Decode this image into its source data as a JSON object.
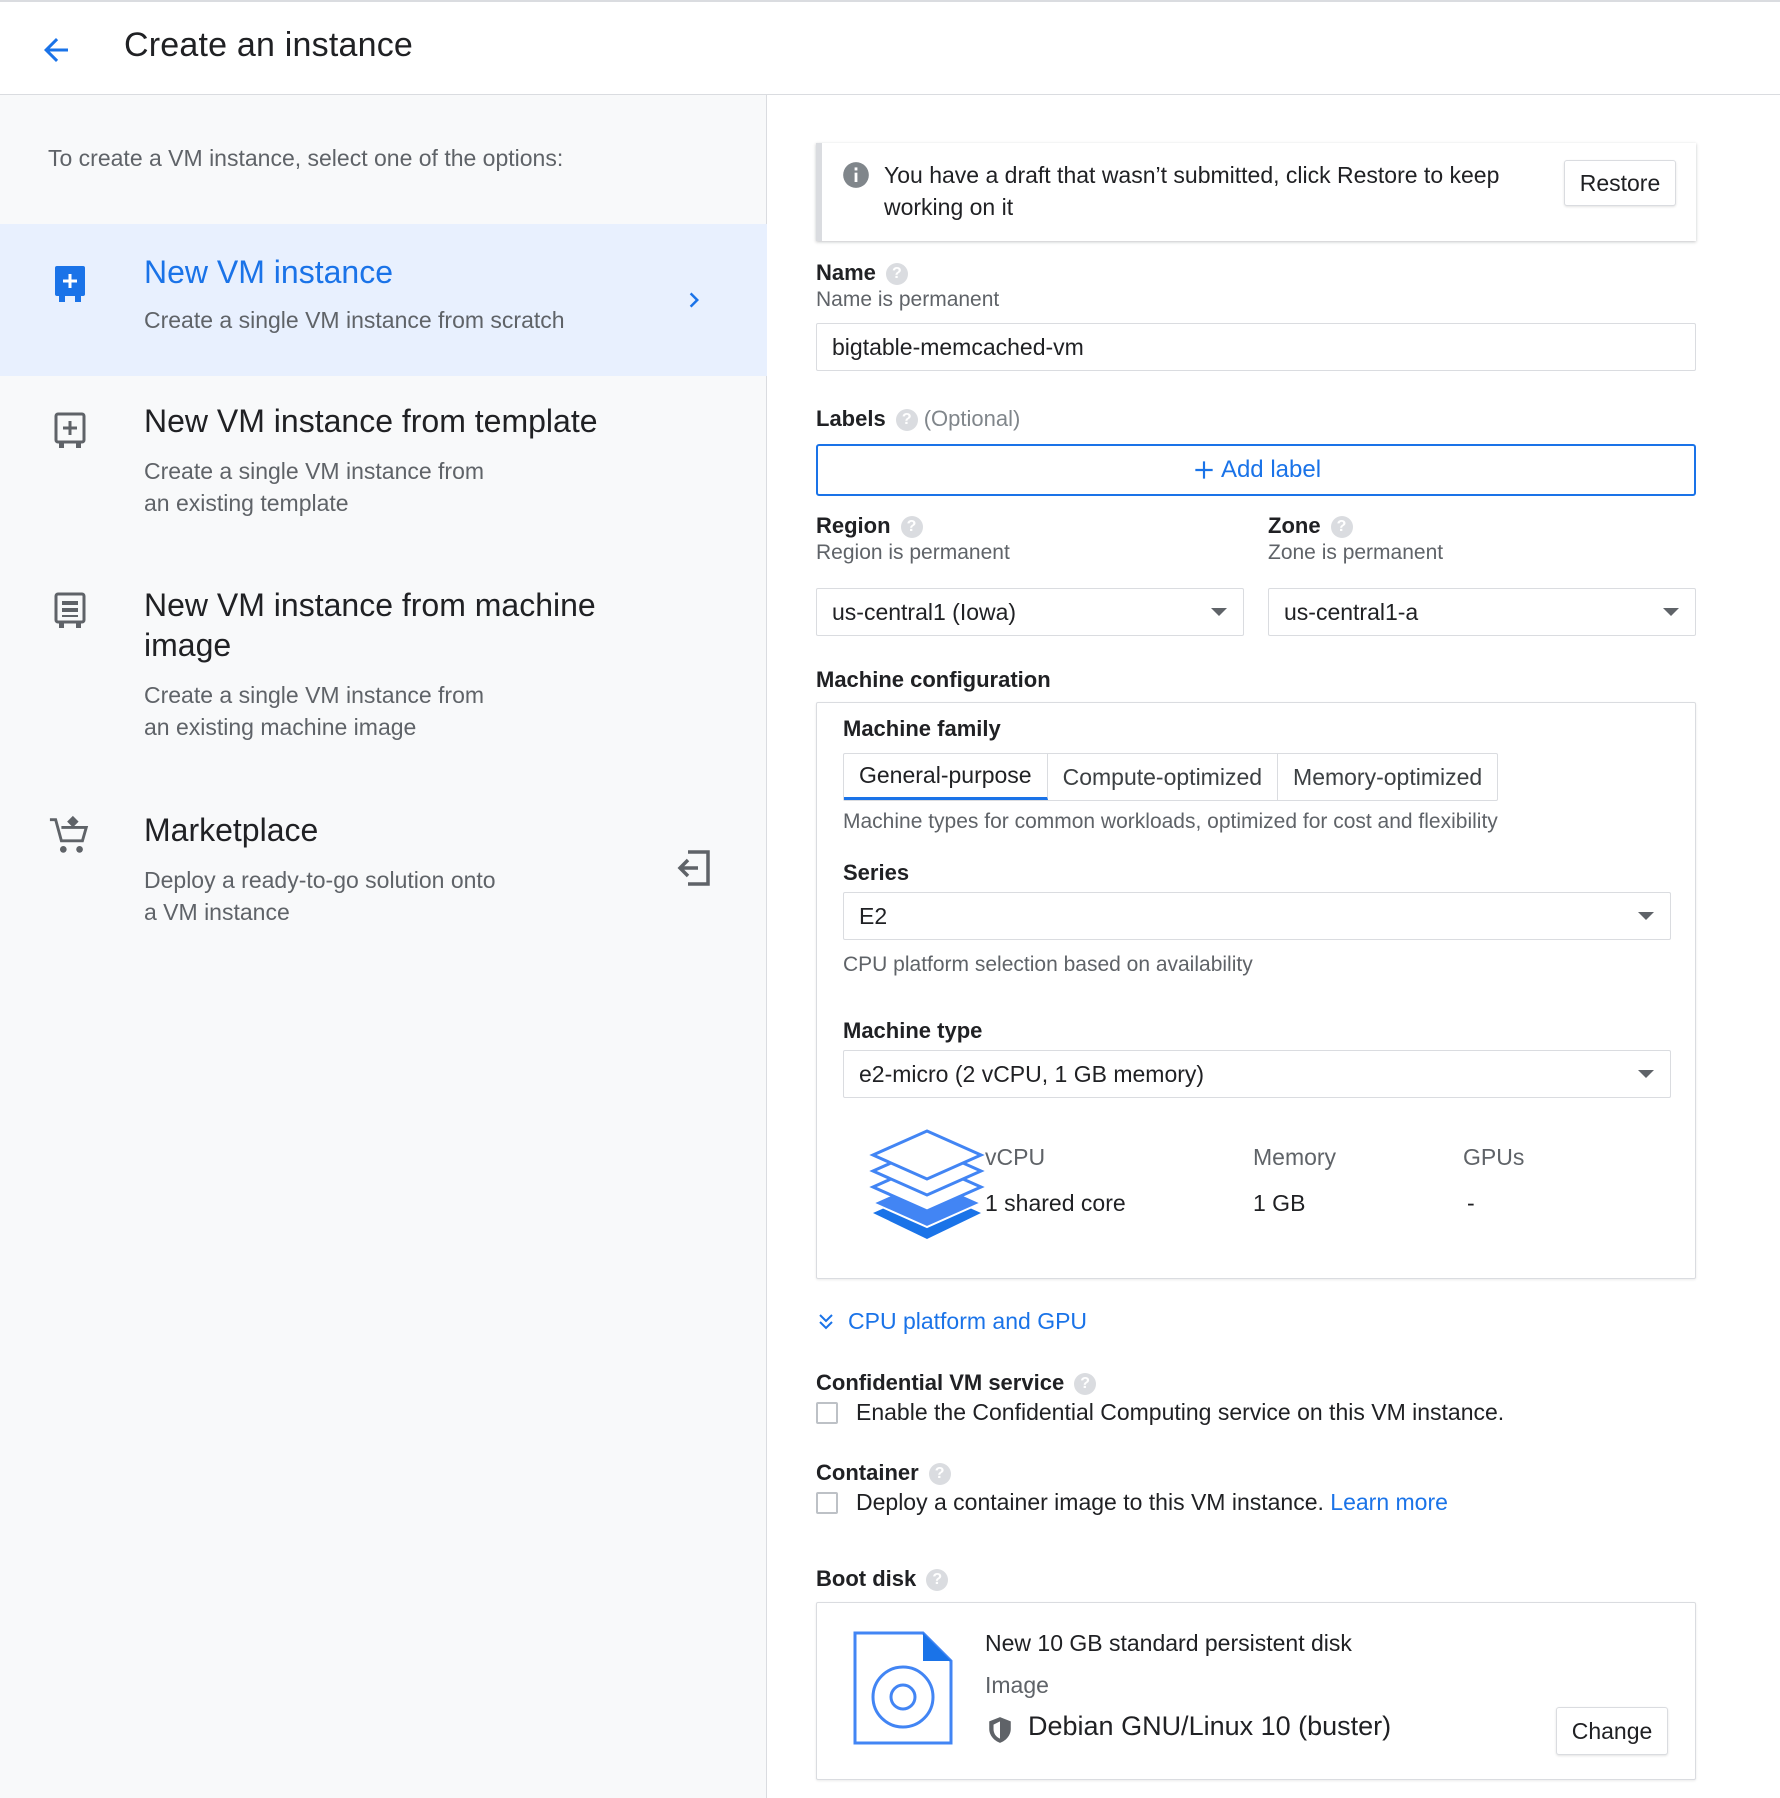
{
  "header": {
    "title": "Create an instance"
  },
  "left": {
    "intro": "To create a VM instance, select one of the options:",
    "options": [
      {
        "title": "New VM instance",
        "desc": "Create a single VM instance from scratch",
        "icon": "add-box-icon"
      },
      {
        "title": "New VM instance from template",
        "desc_line1": "Create a single VM instance from",
        "desc_line2": "an existing template",
        "icon": "template-icon"
      },
      {
        "title_line1": "New VM instance from machine",
        "title_line2": "image",
        "desc_line1": "Create a single VM instance from",
        "desc_line2": "an existing machine image",
        "icon": "machine-image-icon"
      },
      {
        "title": "Marketplace",
        "desc_line1": "Deploy a ready-to-go solution onto",
        "desc_line2": "a VM instance",
        "icon": "cart-icon"
      }
    ]
  },
  "banner": {
    "text": "You have a draft that wasn’t submitted, click Restore to keep working on it",
    "restore_label": "Restore"
  },
  "name": {
    "label": "Name",
    "sublabel": "Name is permanent",
    "value": "bigtable-memcached-vm"
  },
  "labels": {
    "label": "Labels",
    "optional": "(Optional)",
    "add_label": "Add label"
  },
  "region": {
    "label": "Region",
    "sublabel": "Region is permanent",
    "value": "us-central1 (Iowa)"
  },
  "zone": {
    "label": "Zone",
    "sublabel": "Zone is permanent",
    "value": "us-central1-a"
  },
  "machine_config": {
    "label": "Machine configuration",
    "family_label": "Machine family",
    "tabs": [
      "General-purpose",
      "Compute-optimized",
      "Memory-optimized"
    ],
    "family_desc": "Machine types for common workloads, optimized for cost and flexibility",
    "series_label": "Series",
    "series_value": "E2",
    "series_desc": "CPU platform selection based on availability",
    "type_label": "Machine type",
    "type_value": "e2-micro (2 vCPU, 1 GB memory)",
    "specs": {
      "vcpu_h": "vCPU",
      "vcpu_v": "1 shared core",
      "memory_h": "Memory",
      "memory_v": "1 GB",
      "gpus_h": "GPUs",
      "gpus_v": "-"
    }
  },
  "cpu_platform_link": "CPU platform and GPU",
  "confidential": {
    "label": "Confidential VM service",
    "checkbox": "Enable the Confidential Computing service on this VM instance."
  },
  "container": {
    "label": "Container",
    "checkbox": "Deploy a container image to this VM instance.",
    "learn_more": "Learn more"
  },
  "boot_disk": {
    "label": "Boot disk",
    "title": "New 10 GB standard persistent disk",
    "image_label": "Image",
    "image_value": "Debian GNU/Linux 10 (buster)",
    "change_label": "Change"
  },
  "colors": {
    "accent": "#1a73e8",
    "selected_bg": "#e8f0fe",
    "left_bg": "#f8f9fa"
  }
}
